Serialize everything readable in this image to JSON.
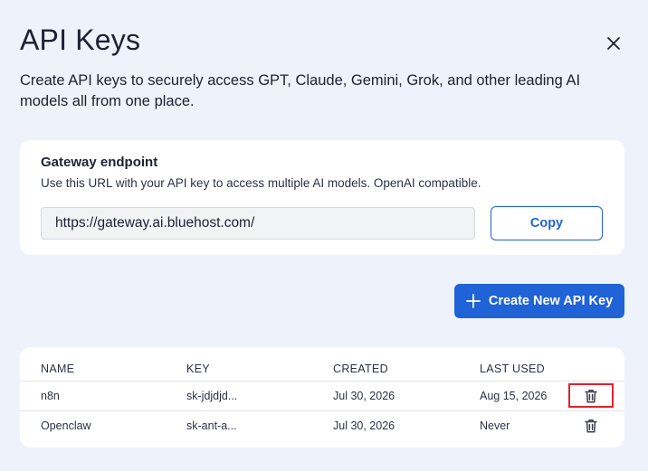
{
  "header": {
    "title": "API Keys",
    "description": "Create API keys to securely access GPT, Claude, Gemini, Grok, and other leading AI models all from one place."
  },
  "gateway": {
    "title": "Gateway endpoint",
    "description": "Use this URL with your API key to access multiple AI models. OpenAI compatible.",
    "url": "https://gateway.ai.bluehost.com/",
    "copy_label": "Copy"
  },
  "actions": {
    "create_label": "Create New API Key"
  },
  "table": {
    "columns": [
      "NAME",
      "KEY",
      "CREATED",
      "LAST USED"
    ],
    "rows": [
      {
        "name": "n8n",
        "key": "sk-jdjdjd...",
        "created": "Jul 30, 2026",
        "last_used": "Aug 15, 2026"
      },
      {
        "name": "Openclaw",
        "key": "sk-ant-a...",
        "created": "Jul 30, 2026",
        "last_used": "Never"
      }
    ]
  },
  "icons": {
    "close": "close-icon",
    "plus": "plus-icon",
    "delete": "trash-icon"
  },
  "colors": {
    "background": "#eef2fb",
    "accent": "#1f63d6",
    "highlight": "#e0222e"
  }
}
